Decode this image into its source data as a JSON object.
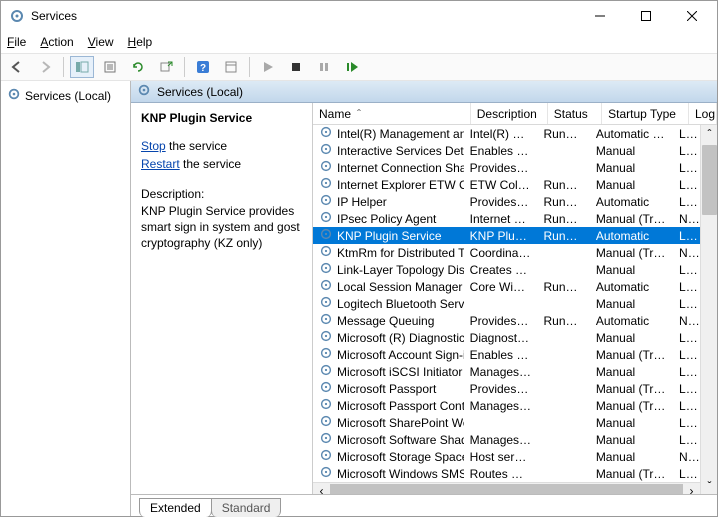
{
  "window": {
    "title": "Services"
  },
  "menubar": {
    "file": "File",
    "action": "Action",
    "view": "View",
    "help": "Help"
  },
  "leftpane": {
    "root": "Services (Local)"
  },
  "paneheader": {
    "title": "Services (Local)"
  },
  "detail": {
    "service_name": "KNP Plugin Service",
    "stop_label": "Stop",
    "stop_suffix": " the service",
    "restart_label": "Restart",
    "restart_suffix": " the service",
    "desc_label": "Description:",
    "desc_text": "KNP Plugin Service provides smart sign in system and gost cryptography (KZ only)"
  },
  "columns": {
    "name": "Name",
    "description": "Description",
    "status": "Status",
    "startup": "Startup Type",
    "logon": "Log"
  },
  "tabs": {
    "extended": "Extended",
    "standard": "Standard"
  },
  "services": [
    {
      "name": "Intel(R) Management and S...",
      "desc": "Intel(R) Ma...",
      "status": "Running",
      "startup": "Automatic (D...",
      "logon": "Loc"
    },
    {
      "name": "Interactive Services Detection",
      "desc": "Enables use...",
      "status": "",
      "startup": "Manual",
      "logon": "Loc"
    },
    {
      "name": "Internet Connection Sharin...",
      "desc": "Provides ne...",
      "status": "",
      "startup": "Manual",
      "logon": "Loc"
    },
    {
      "name": "Internet Explorer ETW Colle...",
      "desc": "ETW Collect...",
      "status": "Running",
      "startup": "Manual",
      "logon": "Loc"
    },
    {
      "name": "IP Helper",
      "desc": "Provides tu...",
      "status": "Running",
      "startup": "Automatic",
      "logon": "Loc"
    },
    {
      "name": "IPsec Policy Agent",
      "desc": "Internet Pro...",
      "status": "Running",
      "startup": "Manual (Trig...",
      "logon": "Net"
    },
    {
      "name": "KNP Plugin Service",
      "desc": "KNP Plugin ...",
      "status": "Running",
      "startup": "Automatic",
      "logon": "Loc",
      "selected": true
    },
    {
      "name": "KtmRm for Distributed Tran...",
      "desc": "Coordinates...",
      "status": "",
      "startup": "Manual (Trig...",
      "logon": "Net"
    },
    {
      "name": "Link-Layer Topology Discov...",
      "desc": "Creates a N...",
      "status": "",
      "startup": "Manual",
      "logon": "Loc"
    },
    {
      "name": "Local Session Manager",
      "desc": "Core Windo...",
      "status": "Running",
      "startup": "Automatic",
      "logon": "Loc"
    },
    {
      "name": "Logitech Bluetooth Service",
      "desc": "",
      "status": "",
      "startup": "Manual",
      "logon": "Loc"
    },
    {
      "name": "Message Queuing",
      "desc": "Provides a ...",
      "status": "Running",
      "startup": "Automatic",
      "logon": "Net"
    },
    {
      "name": "Microsoft (R) Diagnostics H...",
      "desc": "Diagnostics ...",
      "status": "",
      "startup": "Manual",
      "logon": "Loc"
    },
    {
      "name": "Microsoft Account Sign-in ...",
      "desc": "Enables use...",
      "status": "",
      "startup": "Manual (Trig...",
      "logon": "Loc"
    },
    {
      "name": "Microsoft iSCSI Initiator Ser...",
      "desc": "Manages In...",
      "status": "",
      "startup": "Manual",
      "logon": "Loc"
    },
    {
      "name": "Microsoft Passport",
      "desc": "Provides pr...",
      "status": "",
      "startup": "Manual (Trig...",
      "logon": "Loc"
    },
    {
      "name": "Microsoft Passport Container",
      "desc": "Manages lo...",
      "status": "",
      "startup": "Manual (Trig...",
      "logon": "Loc"
    },
    {
      "name": "Microsoft SharePoint Works...",
      "desc": "",
      "status": "",
      "startup": "Manual",
      "logon": "Loc"
    },
    {
      "name": "Microsoft Software Shadow...",
      "desc": "Manages so...",
      "status": "",
      "startup": "Manual",
      "logon": "Loc"
    },
    {
      "name": "Microsoft Storage Spaces S...",
      "desc": "Host service...",
      "status": "",
      "startup": "Manual",
      "logon": "Net"
    },
    {
      "name": "Microsoft Windows SMS Ro...",
      "desc": "Routes mes...",
      "status": "",
      "startup": "Manual (Trig...",
      "logon": "Loc"
    }
  ]
}
